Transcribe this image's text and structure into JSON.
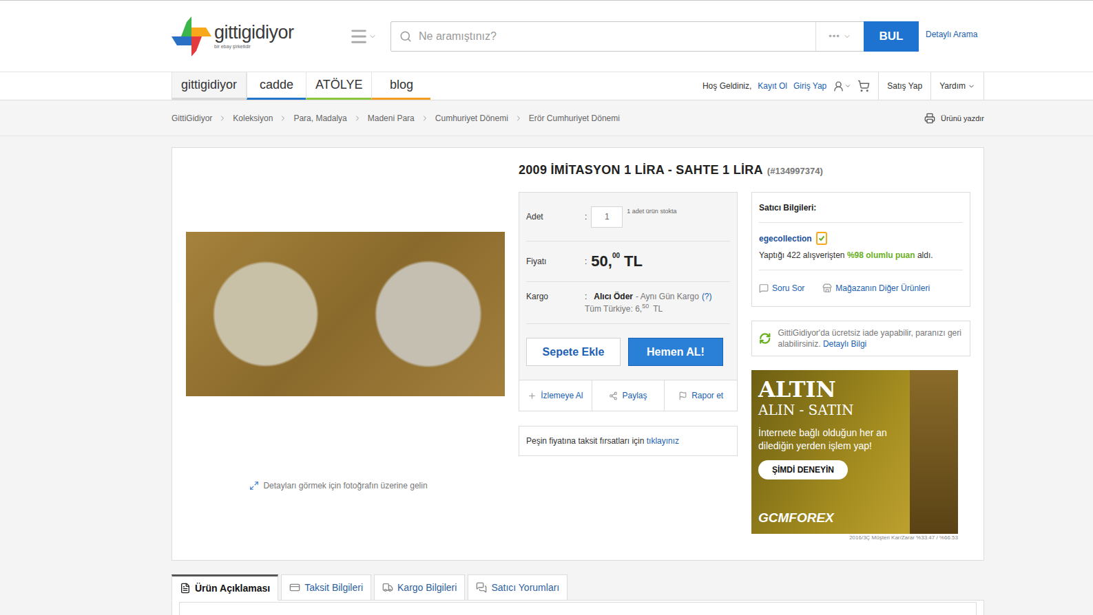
{
  "header": {
    "logo": "gittigidiyor",
    "logo_sub": "bir ebay şirketidir",
    "search": {
      "placeholder": "Ne aramıştınız?",
      "category": "•••",
      "button": "BUL"
    },
    "advanced_search": "Detaylı Arama"
  },
  "nav": {
    "tabs": [
      {
        "label": "gittigidiyor",
        "selected": true,
        "color": "#d9d9d9"
      },
      {
        "label": "cadde",
        "selected": false,
        "color": "#2275c9"
      },
      {
        "label": "ATÖLYE",
        "selected": false,
        "color": "#8cc63f"
      },
      {
        "label": "blog",
        "selected": false,
        "color": "#f39c1f"
      }
    ],
    "greeting": "Hoş Geldiniz,",
    "links": [
      "Kayıt Ol",
      "Giriş Yap"
    ],
    "sell": "Satış Yap",
    "help": "Yardım"
  },
  "breadcrumb": {
    "items": [
      "GittiGidiyor",
      "Koleksiyon",
      "Para, Madalya",
      "Madeni Para",
      "Cumhuriyet Dönemi",
      "Erör Cumhuriyet Dönemi"
    ],
    "print": "Ürünü yazdır"
  },
  "product": {
    "title": "2009 İMİTASYON 1 LİRA - SAHTE 1 LİRA",
    "id": "(#134997374)",
    "image_hint": "Detayları görmek için fotoğrafın üzerine gelin",
    "separator": ":",
    "quantity": {
      "label": "Adet",
      "value": "1",
      "stock": "1 adet ürün stokta"
    },
    "price": {
      "label": "Fiyatı",
      "whole": "50,",
      "cents": "00",
      "currency": "TL"
    },
    "shipping": {
      "label": "Kargo",
      "payer": "Alıcı Öder",
      "note": "- Aynı Gün Kargo",
      "help": "(?)",
      "cost_label": "Tüm Türkiye: 6,",
      "cost_cents": "50",
      "currency": "TL"
    },
    "buttons": [
      "Sepete Ekle",
      "Hemen AL!"
    ],
    "actions": [
      "İzlemeye Al",
      "Paylaş",
      "Rapor et"
    ],
    "installment": {
      "text": "Peşin fiyatına taksit fırsatları için",
      "link": "tıklayınız"
    }
  },
  "seller": {
    "title": "Satıcı Bilgileri:",
    "name": "egecollection",
    "stats_prefix": "Yaptığı 422 alışverişten",
    "rating": "%98 olumlu puan",
    "stats_suffix": "aldı.",
    "links": [
      "Soru Sor",
      "Mağazanın Diğer Ürünleri"
    ]
  },
  "return_notice": {
    "text": "GittiGidiyor'da ücretsiz iade yapabilir, paranızı geri alabilirsiniz.",
    "link": "Detaylı Bilgi"
  },
  "ad": {
    "title": "ALTIN",
    "subtitle": "ALIN - SATIN",
    "text": "İnternete bağlı olduğun her an dilediğin yerden işlem yap!",
    "button": "ŞİMDİ DENEYİN",
    "brand": "GCMFOREX",
    "disclaimer": "2016/3Ç Müşteri Kar/Zarar %33.47 / %66.53"
  },
  "tabs": [
    {
      "label": "Ürün Açıklaması",
      "selected": true
    },
    {
      "label": "Taksit Bilgileri",
      "selected": false
    },
    {
      "label": "Kargo Bilgileri",
      "selected": false
    },
    {
      "label": "Satıcı Yorumları",
      "selected": false
    }
  ]
}
